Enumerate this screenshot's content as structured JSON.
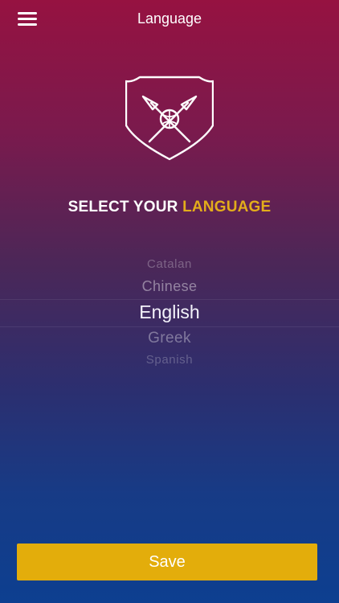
{
  "header": {
    "title": "Language",
    "menu_icon": "hamburger-menu-icon"
  },
  "crest": {
    "icon": "club-crest-icon"
  },
  "heading": {
    "lead": "SELECT YOUR",
    "accent": "LANGUAGE",
    "accent_color": "#e3ad1b"
  },
  "picker": {
    "options": [
      {
        "label": "Catalan"
      },
      {
        "label": "Chinese"
      },
      {
        "label": "English"
      },
      {
        "label": "Greek"
      },
      {
        "label": "Spanish"
      }
    ],
    "selected": "English"
  },
  "footer": {
    "save_label": "Save",
    "save_color": "#e3ad0b"
  }
}
